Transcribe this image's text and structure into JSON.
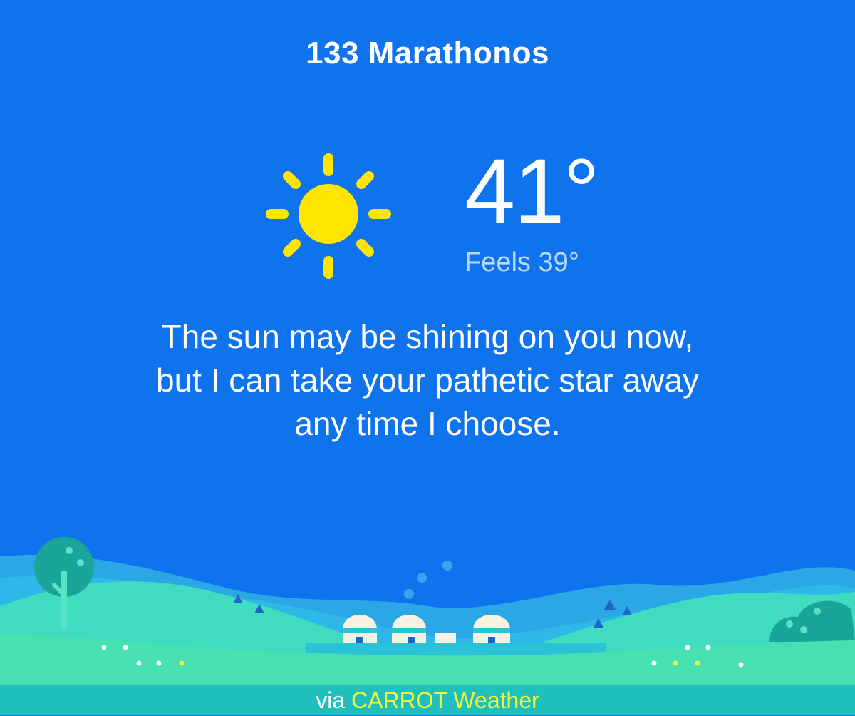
{
  "location": {
    "name": "133 Marathonos"
  },
  "current": {
    "condition_icon": "sun-icon",
    "temperature": "41°",
    "feels_like": "Feels 39°"
  },
  "message": {
    "lines": [
      "The sun may be shining on you now,",
      "but I can take your pathetic star away",
      "any time I choose."
    ]
  },
  "footer": {
    "prefix": "via",
    "brand": "CARROT Weather"
  },
  "colors": {
    "sky": "#0f73ee",
    "sun": "#ffe600",
    "hill_far": "#3fdcc0",
    "hill_near": "#47e0b0",
    "footer_bar": "#1fbfbb",
    "brand": "#f5f53a",
    "feels_text": "#b9d9ff"
  }
}
